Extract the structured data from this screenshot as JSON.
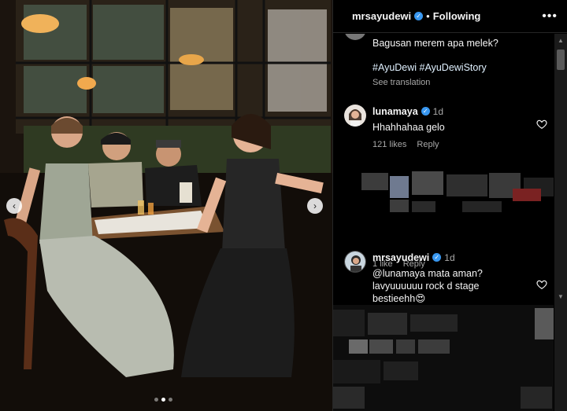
{
  "header": {
    "username": "mrsayudewi",
    "separator": "•",
    "follow_label": "Following",
    "more_icon": "•••"
  },
  "caption": {
    "text": "Bagusan merem apa melek?",
    "hashtags": "#AyuDewi #AyuDewiStory",
    "see_translation": "See translation"
  },
  "comments": [
    {
      "username": "lunamaya",
      "time": "1d",
      "text": "Hhahhahaa gelo",
      "likes": "121 likes",
      "reply": "Reply"
    },
    {
      "username": "",
      "time": "",
      "text": "",
      "likes": "1 like",
      "reply": "Reply"
    },
    {
      "username": "mrsayudewi",
      "time": "1d",
      "text": "@lunamaya mata aman?lavyuuuuuu rock d stage bestieehh😍",
      "likes": "",
      "reply": ""
    }
  ],
  "carousel": {
    "prev_icon": "‹",
    "next_icon": "›",
    "slides": 3,
    "active_slide": 1
  },
  "colors": {
    "verified": "#3897f0",
    "secondary_text": "#a8a8a8",
    "hashtag": "#e0f1ff"
  }
}
